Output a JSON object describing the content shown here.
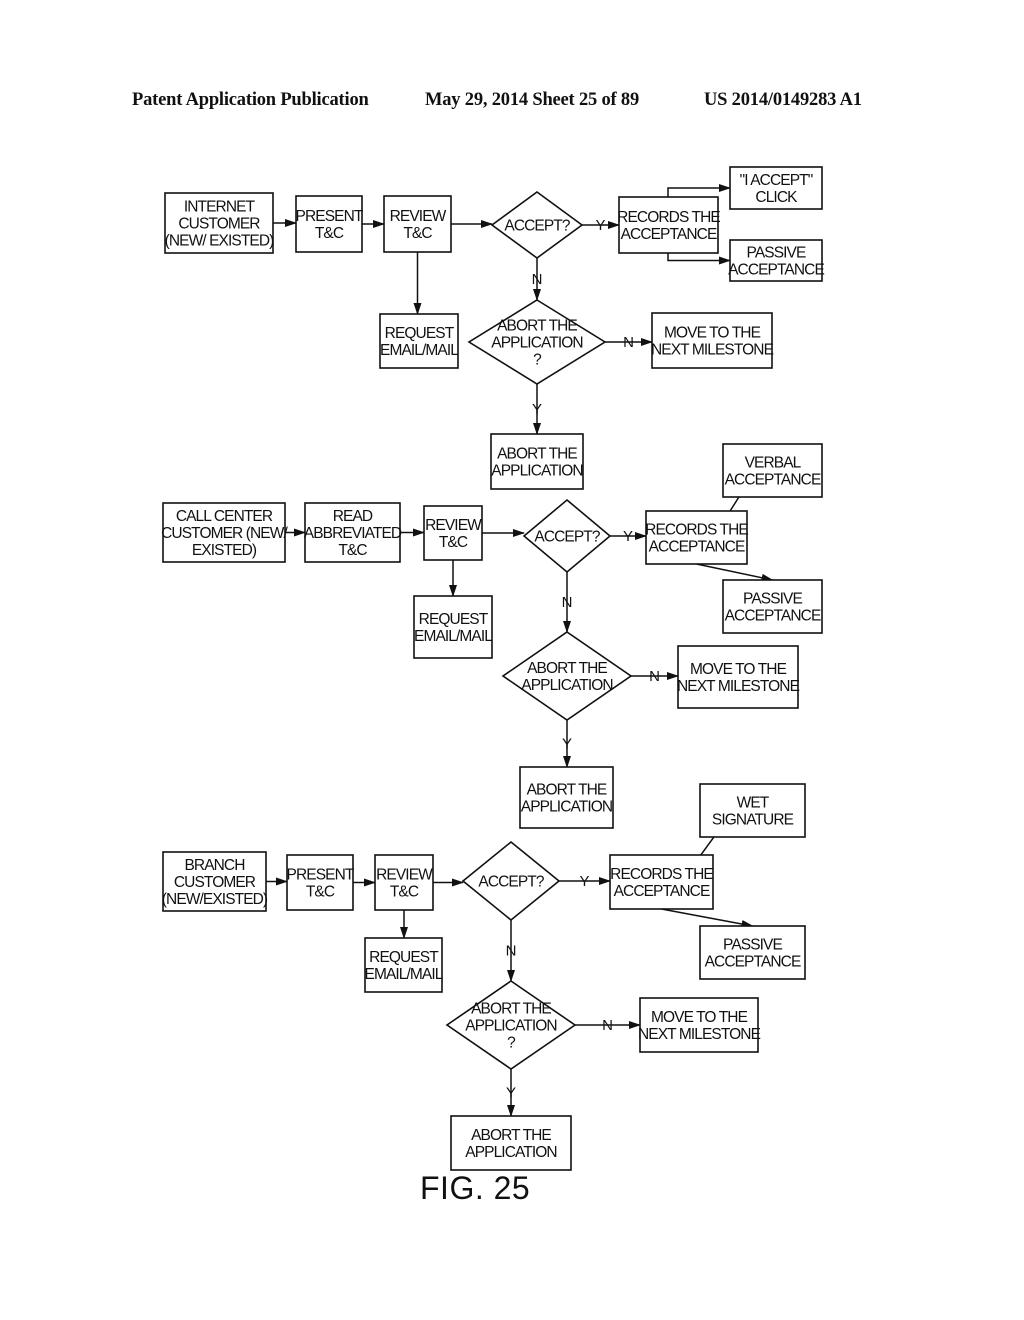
{
  "header": {
    "left": "Patent Application Publication",
    "middle": "May 29, 2014  Sheet 25 of 89",
    "right": "US 2014/0149283 A1"
  },
  "figure": {
    "caption": "FIG. 25"
  },
  "diagram": {
    "nodes": [
      {
        "id": "internet-customer",
        "type": "box",
        "lines": [
          "INTERNET",
          "CUSTOMER",
          "(NEW/ EXISTED)"
        ]
      },
      {
        "id": "present-tc-1",
        "type": "box",
        "lines": [
          "PRESENT",
          "T&C"
        ]
      },
      {
        "id": "review-tc-1",
        "type": "box",
        "lines": [
          "REVIEW",
          "T&C"
        ]
      },
      {
        "id": "accept-1",
        "type": "diamond",
        "lines": [
          "ACCEPT?"
        ]
      },
      {
        "id": "records-acceptance-1",
        "type": "box",
        "lines": [
          "RECORDS THE",
          "ACCEPTANCE"
        ]
      },
      {
        "id": "i-accept-click",
        "type": "box",
        "lines": [
          "\"I ACCEPT\"",
          "CLICK"
        ]
      },
      {
        "id": "passive-acceptance-1",
        "type": "box",
        "lines": [
          "PASSIVE",
          "ACCEPTANCE"
        ]
      },
      {
        "id": "request-email-1",
        "type": "box",
        "lines": [
          "REQUEST",
          "EMAIL/MAIL"
        ]
      },
      {
        "id": "abort-decision-1",
        "type": "diamond",
        "lines": [
          "ABORT THE",
          "APPLICATION",
          "?"
        ]
      },
      {
        "id": "next-milestone-1",
        "type": "box",
        "lines": [
          "MOVE TO THE",
          "NEXT MILESTONE"
        ]
      },
      {
        "id": "abort-app-1",
        "type": "box",
        "lines": [
          "ABORT THE",
          "APPLICATION"
        ]
      },
      {
        "id": "call-center-customer",
        "type": "box",
        "lines": [
          "CALL CENTER",
          "CUSTOMER (NEW/",
          "EXISTED)"
        ]
      },
      {
        "id": "read-abbreviated-tc",
        "type": "box",
        "lines": [
          "READ",
          "ABBREVIATED",
          "T&C"
        ]
      },
      {
        "id": "review-tc-2",
        "type": "box",
        "lines": [
          "REVIEW",
          "T&C"
        ]
      },
      {
        "id": "accept-2",
        "type": "diamond",
        "lines": [
          "ACCEPT?"
        ]
      },
      {
        "id": "records-acceptance-2",
        "type": "box",
        "lines": [
          "RECORDS THE",
          "ACCEPTANCE"
        ]
      },
      {
        "id": "verbal-acceptance",
        "type": "box",
        "lines": [
          "VERBAL",
          "ACCEPTANCE"
        ]
      },
      {
        "id": "passive-acceptance-2",
        "type": "box",
        "lines": [
          "PASSIVE",
          "ACCEPTANCE"
        ]
      },
      {
        "id": "request-email-2",
        "type": "box",
        "lines": [
          "REQUEST",
          "EMAIL/MAIL"
        ]
      },
      {
        "id": "abort-decision-2",
        "type": "diamond",
        "lines": [
          "ABORT THE",
          "APPLICATION"
        ]
      },
      {
        "id": "next-milestone-2",
        "type": "box",
        "lines": [
          "MOVE TO THE",
          "NEXT MILESTONE"
        ]
      },
      {
        "id": "abort-app-2",
        "type": "box",
        "lines": [
          "ABORT THE",
          "APPLICATION"
        ]
      },
      {
        "id": "branch-customer",
        "type": "box",
        "lines": [
          "BRANCH",
          "CUSTOMER",
          "(NEW/EXISTED)"
        ]
      },
      {
        "id": "present-tc-3",
        "type": "box",
        "lines": [
          "PRESENT",
          "T&C"
        ]
      },
      {
        "id": "review-tc-3",
        "type": "box",
        "lines": [
          "REVIEW",
          "T&C"
        ]
      },
      {
        "id": "accept-3",
        "type": "diamond",
        "lines": [
          "ACCEPT?"
        ]
      },
      {
        "id": "records-acceptance-3",
        "type": "box",
        "lines": [
          "RECORDS THE",
          "ACCEPTANCE"
        ]
      },
      {
        "id": "wet-signature",
        "type": "box",
        "lines": [
          "WET",
          "SIGNATURE"
        ]
      },
      {
        "id": "passive-acceptance-3",
        "type": "box",
        "lines": [
          "PASSIVE",
          "ACCEPTANCE"
        ]
      },
      {
        "id": "request-email-3",
        "type": "box",
        "lines": [
          "REQUEST",
          "EMAIL/MAIL"
        ]
      },
      {
        "id": "abort-decision-3",
        "type": "diamond",
        "lines": [
          "ABORT THE",
          "APPLICATION",
          "?"
        ]
      },
      {
        "id": "next-milestone-3",
        "type": "box",
        "lines": [
          "MOVE TO THE",
          "NEXT MILESTONE"
        ]
      },
      {
        "id": "abort-app-3",
        "type": "box",
        "lines": [
          "ABORT THE",
          "APPLICATION"
        ]
      }
    ],
    "edges": [
      {
        "from": "internet-customer",
        "to": "present-tc-1",
        "label": ""
      },
      {
        "from": "present-tc-1",
        "to": "review-tc-1",
        "label": ""
      },
      {
        "from": "review-tc-1",
        "to": "accept-1",
        "label": ""
      },
      {
        "from": "review-tc-1",
        "to": "request-email-1",
        "label": ""
      },
      {
        "from": "accept-1",
        "to": "records-acceptance-1",
        "label": "Y"
      },
      {
        "from": "accept-1",
        "to": "abort-decision-1",
        "label": "N"
      },
      {
        "from": "records-acceptance-1",
        "to": "i-accept-click",
        "label": ""
      },
      {
        "from": "records-acceptance-1",
        "to": "passive-acceptance-1",
        "label": ""
      },
      {
        "from": "abort-decision-1",
        "to": "next-milestone-1",
        "label": "N"
      },
      {
        "from": "abort-decision-1",
        "to": "abort-app-1",
        "label": "Y"
      },
      {
        "from": "call-center-customer",
        "to": "read-abbreviated-tc",
        "label": ""
      },
      {
        "from": "read-abbreviated-tc",
        "to": "review-tc-2",
        "label": ""
      },
      {
        "from": "review-tc-2",
        "to": "accept-2",
        "label": ""
      },
      {
        "from": "review-tc-2",
        "to": "request-email-2",
        "label": ""
      },
      {
        "from": "accept-2",
        "to": "records-acceptance-2",
        "label": "Y"
      },
      {
        "from": "accept-2",
        "to": "abort-decision-2",
        "label": "N"
      },
      {
        "from": "records-acceptance-2",
        "to": "verbal-acceptance",
        "label": ""
      },
      {
        "from": "records-acceptance-2",
        "to": "passive-acceptance-2",
        "label": ""
      },
      {
        "from": "abort-decision-2",
        "to": "next-milestone-2",
        "label": "N"
      },
      {
        "from": "abort-decision-2",
        "to": "abort-app-2",
        "label": "Y"
      },
      {
        "from": "branch-customer",
        "to": "present-tc-3",
        "label": ""
      },
      {
        "from": "present-tc-3",
        "to": "review-tc-3",
        "label": ""
      },
      {
        "from": "review-tc-3",
        "to": "accept-3",
        "label": ""
      },
      {
        "from": "review-tc-3",
        "to": "request-email-3",
        "label": ""
      },
      {
        "from": "accept-3",
        "to": "records-acceptance-3",
        "label": "Y"
      },
      {
        "from": "accept-3",
        "to": "abort-decision-3",
        "label": "N"
      },
      {
        "from": "records-acceptance-3",
        "to": "wet-signature",
        "label": ""
      },
      {
        "from": "records-acceptance-3",
        "to": "passive-acceptance-3",
        "label": ""
      },
      {
        "from": "abort-decision-3",
        "to": "next-milestone-3",
        "label": "N"
      },
      {
        "from": "abort-decision-3",
        "to": "abort-app-3",
        "label": "Y"
      }
    ]
  }
}
